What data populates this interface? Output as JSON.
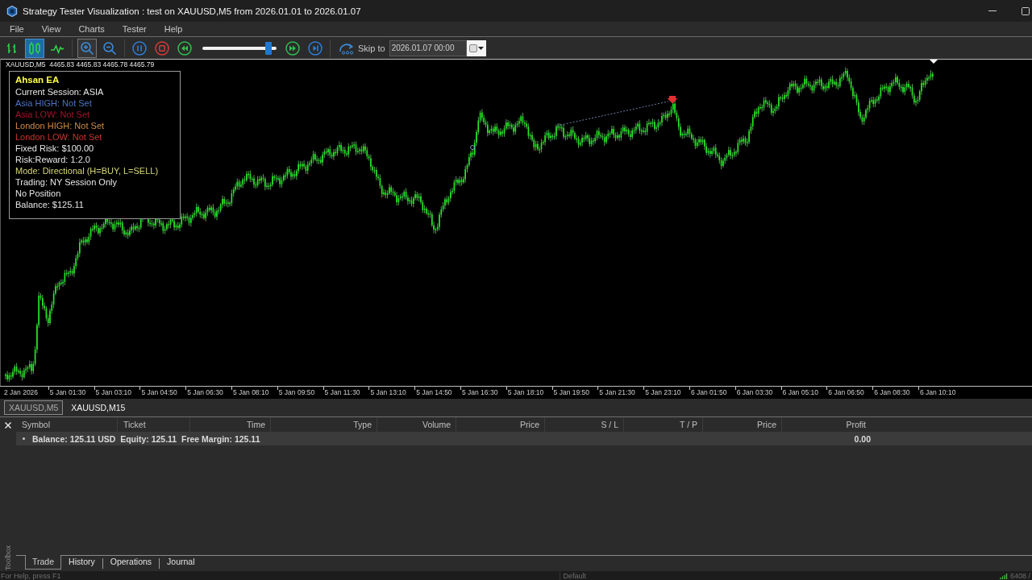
{
  "window": {
    "title": "Strategy Tester Visualization : test on XAUUSD,M5 from 2026.01.01 to 2026.01.07"
  },
  "menu": [
    "File",
    "View",
    "Charts",
    "Tester",
    "Help"
  ],
  "toolbar": {
    "chart_types": [
      {
        "kind": "bars",
        "selected": false
      },
      {
        "kind": "candles",
        "selected": true
      },
      {
        "kind": "line",
        "selected": false
      }
    ],
    "zoom": [
      {
        "kind": "in",
        "hovered": true
      },
      {
        "kind": "out",
        "hovered": false
      }
    ],
    "speed": {
      "level": 0.89
    },
    "skip_to": {
      "label": "Skip to",
      "value": "2026.01.07 00:00"
    }
  },
  "chart": {
    "header": "XAUUSD,M5  4465.83 4465.83 4465.78 4465.79",
    "info_panel": {
      "title": "Ahsan EA",
      "lines": [
        {
          "text": "Current Session: ASIA",
          "color": "#e6e6e6"
        },
        {
          "text": "Asia HIGH: Not Set",
          "color": "#4f73c8"
        },
        {
          "text": "Asia LOW: Not Set",
          "color": "#a3142c"
        },
        {
          "text": "London HIGH: Not Set",
          "color": "#d08a45"
        },
        {
          "text": "London LOW: Not Set",
          "color": "#c4372c"
        },
        {
          "text": "Fixed Risk: $100.00",
          "color": "#e6e6e6"
        },
        {
          "text": "Risk:Reward: 1:2.0",
          "color": "#e6e6e6"
        },
        {
          "text": "Mode: Directional (H=BUY, L=SELL)",
          "color": "#d6d67a"
        },
        {
          "text": "Trading: NY Session Only",
          "color": "#e6e6e6"
        },
        {
          "text": "No Position",
          "color": "#e6e6e6"
        },
        {
          "text": "Balance: $125.11",
          "color": "#e6e6e6"
        }
      ]
    },
    "x_axis": [
      "2 Jan 2026",
      "5 Jan 01:30",
      "5 Jan 03:10",
      "5 Jan 04:50",
      "5 Jan 06:30",
      "5 Jan 08:10",
      "5 Jan 09:50",
      "5 Jan 11:30",
      "5 Jan 13:10",
      "5 Jan 14:50",
      "5 Jan 16:30",
      "5 Jan 18:10",
      "5 Jan 19:50",
      "5 Jan 21:30",
      "5 Jan 23:10",
      "6 Jan 01:50",
      "6 Jan 03:30",
      "6 Jan 05:10",
      "6 Jan 06:50",
      "6 Jan 08:30",
      "6 Jan 10:10"
    ]
  },
  "chart_tabs": [
    {
      "label": "XAUUSD,M5",
      "selected": true
    },
    {
      "label": "XAUUSD,M15",
      "selected": false
    }
  ],
  "toolbox": {
    "title": "Toolbox",
    "columns": [
      "Symbol",
      "Ticket",
      "Time",
      "Type",
      "Volume",
      "Price",
      "S / L",
      "T / P",
      "Price",
      "Profit"
    ],
    "rows": [
      {
        "summary": "Balance: 125.11 USD  Equity: 125.11  Free Margin: 125.11",
        "profit": "0.00"
      }
    ],
    "tabs": [
      {
        "label": "Trade",
        "selected": true
      },
      {
        "label": "History",
        "selected": false
      },
      {
        "label": "Operations",
        "selected": false
      },
      {
        "label": "Journal",
        "selected": false
      }
    ]
  },
  "status_bar": {
    "help": "For Help, press F1",
    "profile": "Default",
    "connection": "6408 /"
  }
}
